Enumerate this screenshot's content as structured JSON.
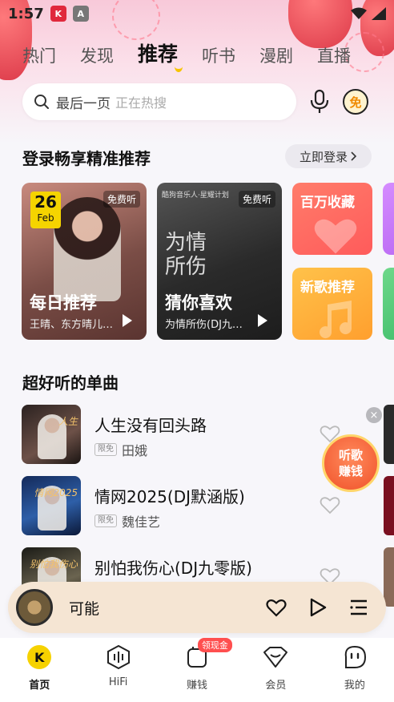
{
  "status_bar": {
    "time": "1:57"
  },
  "top_tabs": [
    {
      "label": "热门"
    },
    {
      "label": "发现"
    },
    {
      "label": "推荐",
      "active": true
    },
    {
      "label": "听书"
    },
    {
      "label": "漫剧"
    },
    {
      "label": "直播"
    }
  ],
  "search": {
    "text": "最后一页",
    "hint": "正在热搜"
  },
  "free_button_label": "免",
  "login_section": {
    "title": "登录畅享精准推荐",
    "button_label": "立即登录",
    "cards": [
      {
        "title": "每日推荐",
        "subtitle": "王晴、东方晴儿…",
        "badge": "免费听",
        "date_day": "26",
        "date_month": "Feb"
      },
      {
        "title": "猜你喜欢",
        "subtitle": "为情所伤(DJ九…",
        "badge": "免费听",
        "top_text": "酷狗音乐人·星耀计划",
        "art_text": "为情所伤"
      }
    ],
    "mini_cards": [
      {
        "label": "百万收藏",
        "color": "#ff6a5f"
      },
      {
        "label": "新歌推荐",
        "color": "#ffae3a"
      }
    ]
  },
  "singles_section": {
    "title": "超好听的单曲",
    "songs": [
      {
        "title": "人生没有回头路",
        "tag": "限免",
        "artist": "田娥",
        "cover_text": "人生"
      },
      {
        "title": "情网2025(DJ默涵版)",
        "tag": "限免",
        "artist": "魏佳艺",
        "cover_text": "情网2025"
      },
      {
        "title": "别怕我伤心(DJ九零版)",
        "tag": "",
        "artist": "",
        "cover_text": "别怕我伤心"
      }
    ]
  },
  "earn_float": {
    "line1": "听歌",
    "line2": "赚钱",
    "close": "×"
  },
  "player": {
    "title": "可能"
  },
  "bottom_nav": [
    {
      "label": "首页",
      "icon": "kugou-logo-icon",
      "active": true
    },
    {
      "label": "HiFi",
      "icon": "hifi-icon"
    },
    {
      "label": "赚钱",
      "icon": "earn-icon",
      "badge": "领现金"
    },
    {
      "label": "会员",
      "icon": "vip-icon"
    },
    {
      "label": "我的",
      "icon": "profile-icon"
    }
  ],
  "colors": {
    "accent": "#f6d200",
    "player_bg": "#f5e5d3",
    "festive_pink": "#f8c9d9"
  }
}
